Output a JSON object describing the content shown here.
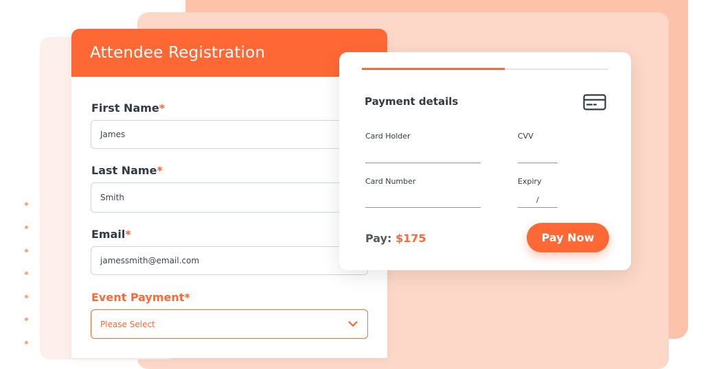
{
  "registration": {
    "title": "Attendee Registration",
    "first_name": {
      "label": "First Name",
      "required_mark": "*",
      "value": "James"
    },
    "last_name": {
      "label": "Last Name",
      "required_mark": "*",
      "value": "Smith"
    },
    "email": {
      "label": "Email",
      "required_mark": "*",
      "value": "jamessmith@email.com"
    },
    "event_payment": {
      "label": "Event Payment",
      "required_mark": "*",
      "selected": "Please Select"
    }
  },
  "payment": {
    "title": "Payment details",
    "progress_fraction": 0.58,
    "card_holder_label": "Card Holder",
    "cvv_label": "CVV",
    "card_number_label": "Card Number",
    "expiry_label": "Expiry",
    "expiry_separator": "/",
    "pay_label": "Pay:",
    "pay_amount": "$175",
    "pay_button": "Pay Now"
  },
  "colors": {
    "accent": "#fe6835",
    "text_dark": "#323a45"
  },
  "icons": {
    "card": "credit-card-icon",
    "dropdown": "chevron-down-icon"
  }
}
